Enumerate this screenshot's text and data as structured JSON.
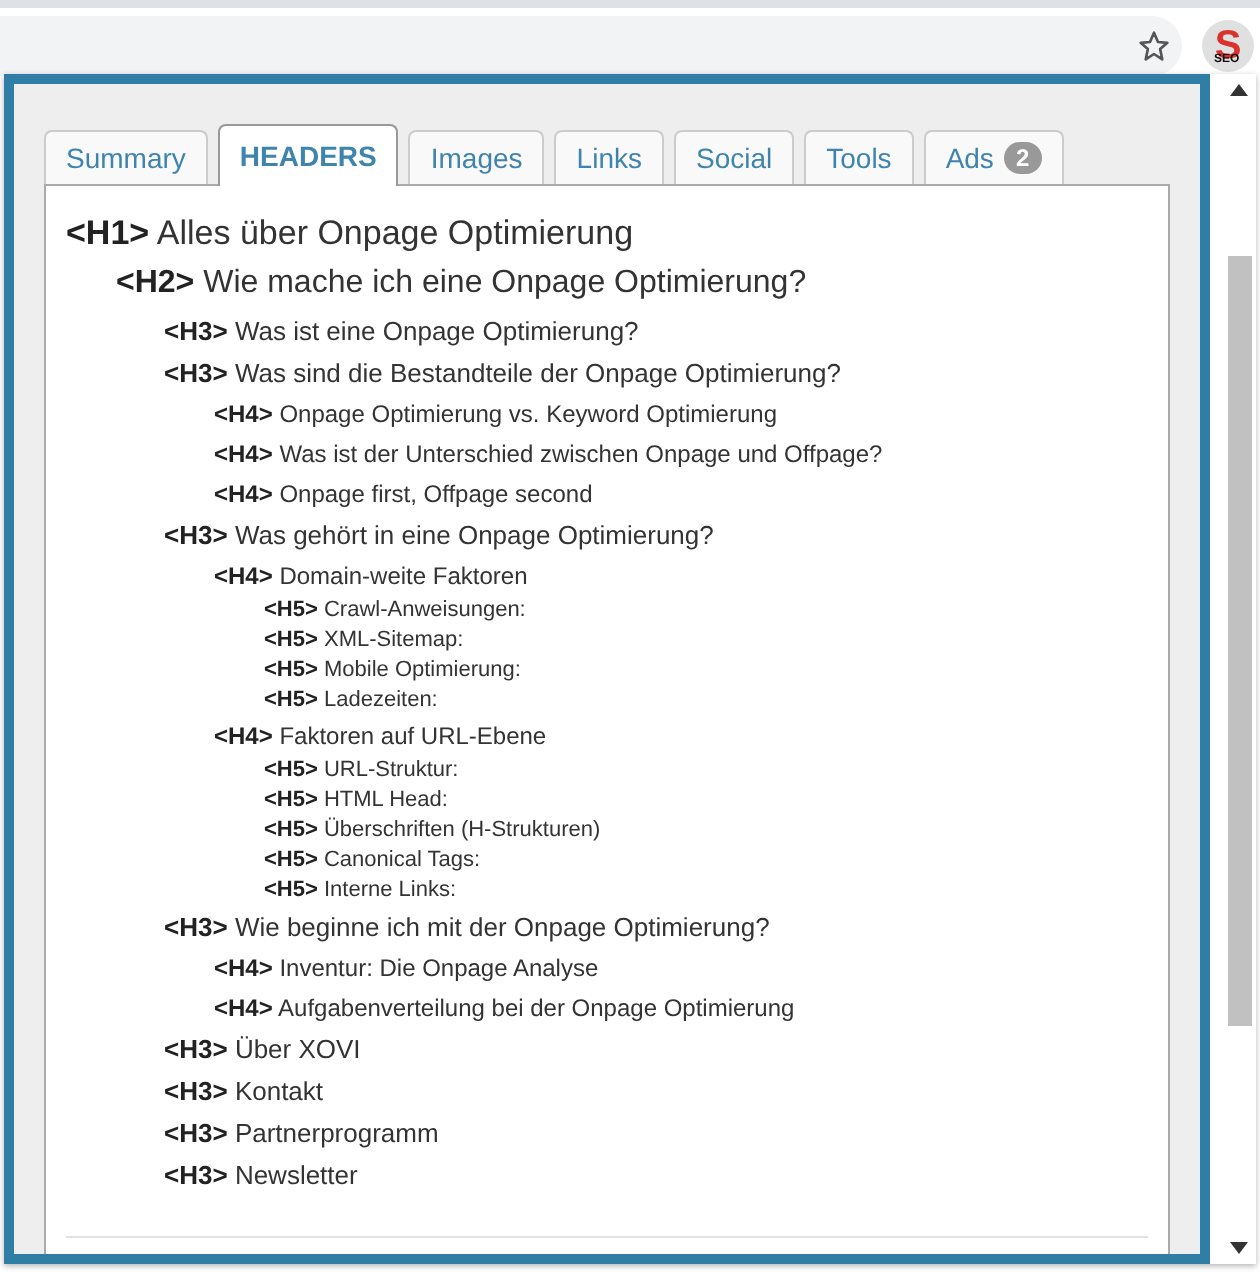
{
  "toolbar": {
    "extension": {
      "letter": "S",
      "caption": "SEO"
    }
  },
  "tabs": [
    {
      "label": "Summary",
      "selected": false
    },
    {
      "label": "HEADERS",
      "selected": true
    },
    {
      "label": "Images",
      "selected": false
    },
    {
      "label": "Links",
      "selected": false
    },
    {
      "label": "Social",
      "selected": false
    },
    {
      "label": "Tools",
      "selected": false
    },
    {
      "label": "Ads",
      "selected": false,
      "badge": "2"
    }
  ],
  "headers": [
    {
      "tag": "<H1>",
      "text": "Alles über Onpage Optimierung",
      "children": [
        {
          "tag": "<H2>",
          "text": "Wie mache ich eine Onpage Optimierung?",
          "children": [
            {
              "tag": "<H3>",
              "text": "Was ist eine Onpage Optimierung?"
            },
            {
              "tag": "<H3>",
              "text": "Was sind die Bestandteile der Onpage Optimierung?",
              "children": [
                {
                  "tag": "<H4>",
                  "text": "Onpage Optimierung vs. Keyword Optimierung"
                },
                {
                  "tag": "<H4>",
                  "text": "Was ist der Unterschied zwischen Onpage und Offpage?"
                },
                {
                  "tag": "<H4>",
                  "text": "Onpage first, Offpage second"
                }
              ]
            },
            {
              "tag": "<H3>",
              "text": "Was gehört in eine Onpage Optimierung?",
              "children": [
                {
                  "tag": "<H4>",
                  "text": "Domain-weite Faktoren",
                  "children": [
                    {
                      "tag": "<H5>",
                      "text": "Crawl-Anweisungen:"
                    },
                    {
                      "tag": "<H5>",
                      "text": "XML-Sitemap:"
                    },
                    {
                      "tag": "<H5>",
                      "text": "Mobile Optimierung:"
                    },
                    {
                      "tag": "<H5>",
                      "text": "Ladezeiten:"
                    }
                  ]
                },
                {
                  "tag": "<H4>",
                  "text": "Faktoren auf URL-Ebene",
                  "children": [
                    {
                      "tag": "<H5>",
                      "text": "URL-Struktur:"
                    },
                    {
                      "tag": "<H5>",
                      "text": "HTML Head:"
                    },
                    {
                      "tag": "<H5>",
                      "text": "Überschriften (H-Strukturen)"
                    },
                    {
                      "tag": "<H5>",
                      "text": "Canonical Tags:"
                    },
                    {
                      "tag": "<H5>",
                      "text": "Interne Links:"
                    }
                  ]
                }
              ]
            },
            {
              "tag": "<H3>",
              "text": "Wie beginne ich mit der Onpage Optimierung?",
              "children": [
                {
                  "tag": "<H4>",
                  "text": "Inventur: Die Onpage Analyse"
                },
                {
                  "tag": "<H4>",
                  "text": "Aufgabenverteilung bei der Onpage Optimierung"
                }
              ]
            },
            {
              "tag": "<H3>",
              "text": "Über XOVI"
            },
            {
              "tag": "<H3>",
              "text": "Kontakt"
            },
            {
              "tag": "<H3>",
              "text": "Partnerprogramm"
            },
            {
              "tag": "<H3>",
              "text": "Newsletter"
            }
          ]
        }
      ]
    }
  ]
}
